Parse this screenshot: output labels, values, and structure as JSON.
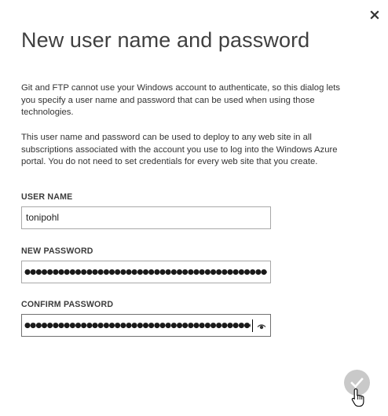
{
  "dialog": {
    "title": "New user name and password",
    "paragraphs": [
      "Git and FTP cannot use your Windows account to authenticate, so this dialog lets you specify a user name and password that can be used when using those technologies.",
      "This user name and password can be used to deploy to any web site in all subscriptions associated with the account you use to log into the Windows Azure portal. You do not need to set credentials for every web site that you create."
    ],
    "close_icon": "close-icon"
  },
  "form": {
    "user_name": {
      "label": "USER NAME",
      "value": "tonipohl"
    },
    "new_password": {
      "label": "NEW PASSWORD",
      "masked": "●●●●●●●●●●●●●●●●●●●●●●●●●●●●●●●●●●●●●●●●●●●●●●"
    },
    "confirm_password": {
      "label": "CONFIRM PASSWORD",
      "masked": "●●●●●●●●●●●●●●●●●●●●●●●●●●●●●●●●●●●●●●●●●●●●●●",
      "reveal_icon": "eye-icon"
    }
  },
  "actions": {
    "ok_icon": "checkmark-icon",
    "cursor_icon": "hand-pointer-icon"
  }
}
